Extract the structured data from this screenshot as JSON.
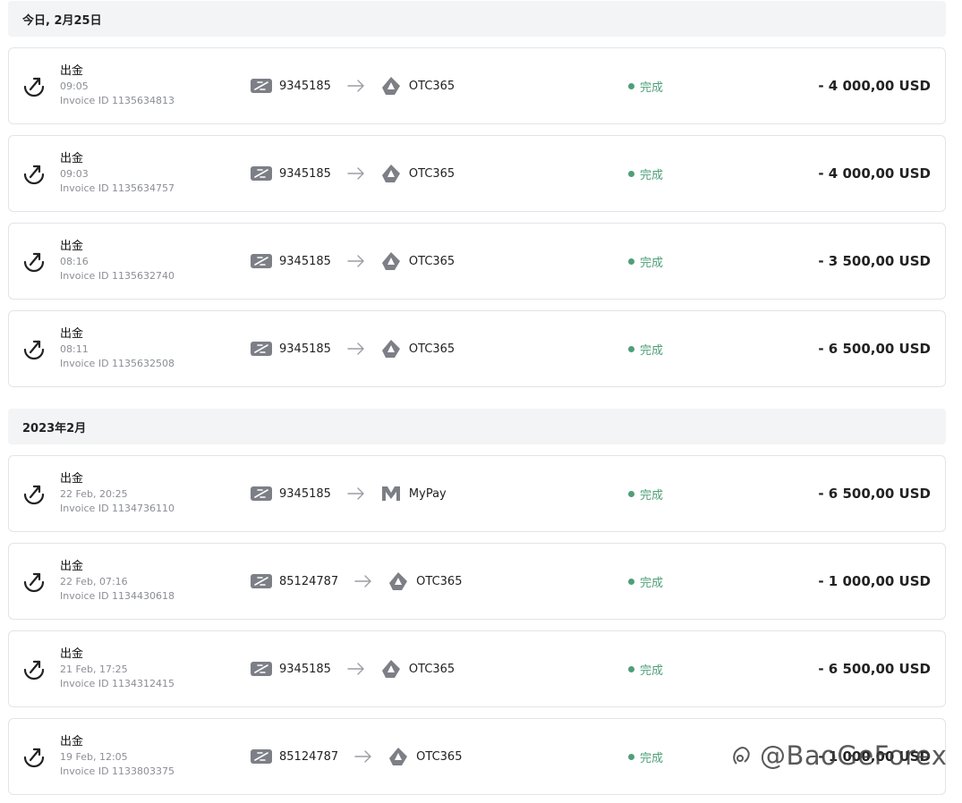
{
  "groups": [
    {
      "header": "今日, 2月25日",
      "rows": [
        {
          "title": "出金",
          "time": "09:05",
          "invoice": "Invoice ID 1135634813",
          "from_account": "9345185",
          "to_name": "OTC365",
          "to_logo": "otc365-logo-icon",
          "status": "完成",
          "amount": "- 4 000,00 USD"
        },
        {
          "title": "出金",
          "time": "09:03",
          "invoice": "Invoice ID 1135634757",
          "from_account": "9345185",
          "to_name": "OTC365",
          "to_logo": "otc365-logo-icon",
          "status": "完成",
          "amount": "- 4 000,00 USD"
        },
        {
          "title": "出金",
          "time": "08:16",
          "invoice": "Invoice ID 1135632740",
          "from_account": "9345185",
          "to_name": "OTC365",
          "to_logo": "otc365-logo-icon",
          "status": "完成",
          "amount": "- 3 500,00 USD"
        },
        {
          "title": "出金",
          "time": "08:11",
          "invoice": "Invoice ID 1135632508",
          "from_account": "9345185",
          "to_name": "OTC365",
          "to_logo": "otc365-logo-icon",
          "status": "完成",
          "amount": "- 6 500,00 USD"
        }
      ]
    },
    {
      "header": "2023年2月",
      "rows": [
        {
          "title": "出金",
          "time": "22 Feb, 20:25",
          "invoice": "Invoice ID 1134736110",
          "from_account": "9345185",
          "to_name": "MyPay",
          "to_logo": "mypay-logo-icon",
          "status": "完成",
          "amount": "- 6 500,00 USD"
        },
        {
          "title": "出金",
          "time": "22 Feb, 07:16",
          "invoice": "Invoice ID 1134430618",
          "from_account": "85124787",
          "to_name": "OTC365",
          "to_logo": "otc365-logo-icon",
          "status": "完成",
          "amount": "- 1 000,00 USD"
        },
        {
          "title": "出金",
          "time": "21 Feb, 17:25",
          "invoice": "Invoice ID 1134312415",
          "from_account": "9345185",
          "to_name": "OTC365",
          "to_logo": "otc365-logo-icon",
          "status": "完成",
          "amount": "- 6 500,00 USD"
        },
        {
          "title": "出金",
          "time": "19 Feb, 12:05",
          "invoice": "Invoice ID 1133803375",
          "from_account": "85124787",
          "to_name": "OTC365",
          "to_logo": "otc365-logo-icon",
          "status": "完成",
          "amount": "- 1 000,00 USD"
        }
      ]
    }
  ],
  "watermark": "@BaoGeForex",
  "colors": {
    "status_green": "#4e9f78",
    "header_bg": "#f3f4f6",
    "border": "#e3e4e8",
    "muted": "#8b8e95"
  }
}
